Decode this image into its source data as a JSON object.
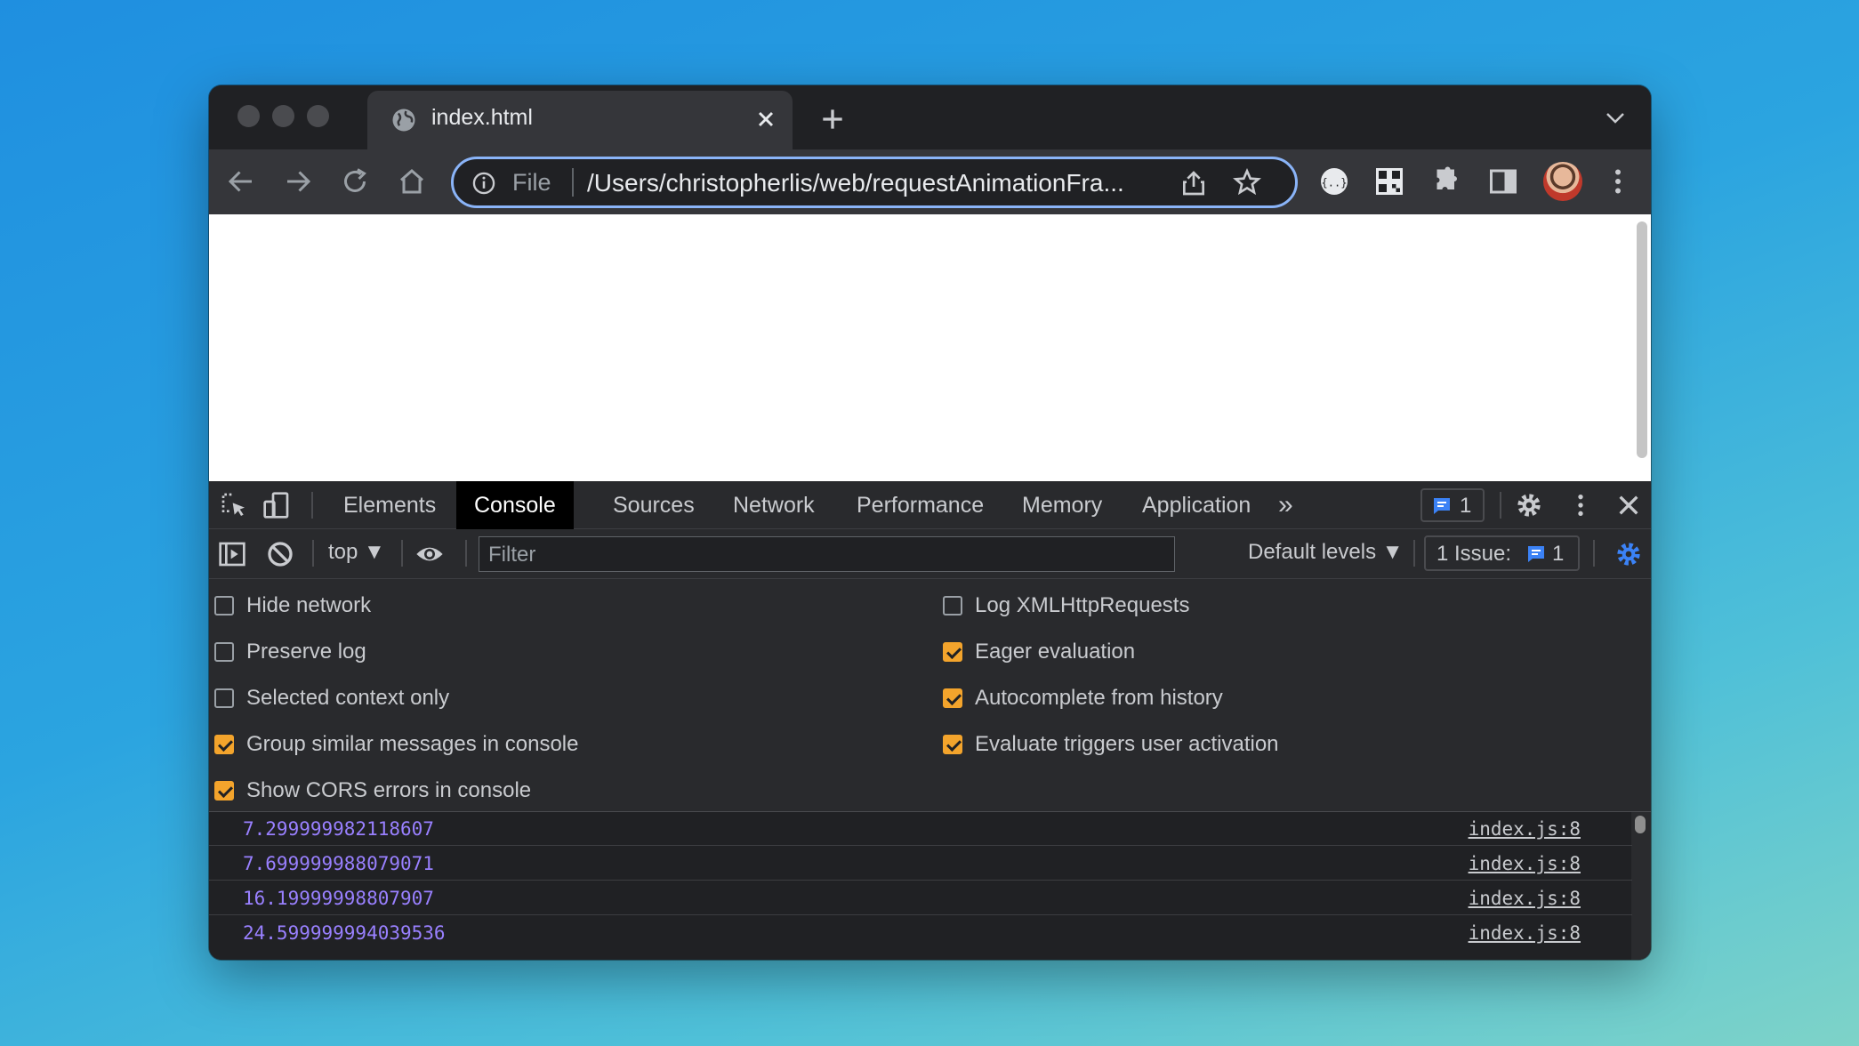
{
  "browser": {
    "tab_title": "index.html",
    "omnibox": {
      "scheme": "File",
      "url": "/Users/christopherlis/web/requestAnimationFra..."
    }
  },
  "devtools": {
    "tabs": [
      {
        "label": "Elements"
      },
      {
        "label": "Console"
      },
      {
        "label": "Sources"
      },
      {
        "label": "Network"
      },
      {
        "label": "Performance"
      },
      {
        "label": "Memory"
      },
      {
        "label": "Application"
      }
    ],
    "more_tabs": "»",
    "messages_count": "1",
    "console_toolbar": {
      "context": "top ▼",
      "filter_placeholder": "Filter",
      "levels": "Default levels ▼",
      "issues_label": "1 Issue:",
      "issues_count": "1"
    },
    "settings": {
      "left": [
        {
          "label": "Hide network",
          "checked": false
        },
        {
          "label": "Preserve log",
          "checked": false
        },
        {
          "label": "Selected context only",
          "checked": false
        },
        {
          "label": "Group similar messages in console",
          "checked": true
        },
        {
          "label": "Show CORS errors in console",
          "checked": true
        }
      ],
      "right": [
        {
          "label": "Log XMLHttpRequests",
          "checked": false
        },
        {
          "label": "Eager evaluation",
          "checked": true
        },
        {
          "label": "Autocomplete from history",
          "checked": true
        },
        {
          "label": "Evaluate triggers user activation",
          "checked": true
        }
      ]
    },
    "console_rows": [
      {
        "value": "7.299999982118607",
        "source": "index.js:8"
      },
      {
        "value": "7.699999988079071",
        "source": "index.js:8"
      },
      {
        "value": "16.19999998807907",
        "source": "index.js:8"
      },
      {
        "value": "24.599999994039536",
        "source": "index.js:8"
      }
    ]
  },
  "colors": {
    "accent_checkbox": "#f3a42c",
    "omnibox_focus": "#8ab4f8",
    "console_number": "#9980ff",
    "badge_blue": "#3b82f6"
  }
}
